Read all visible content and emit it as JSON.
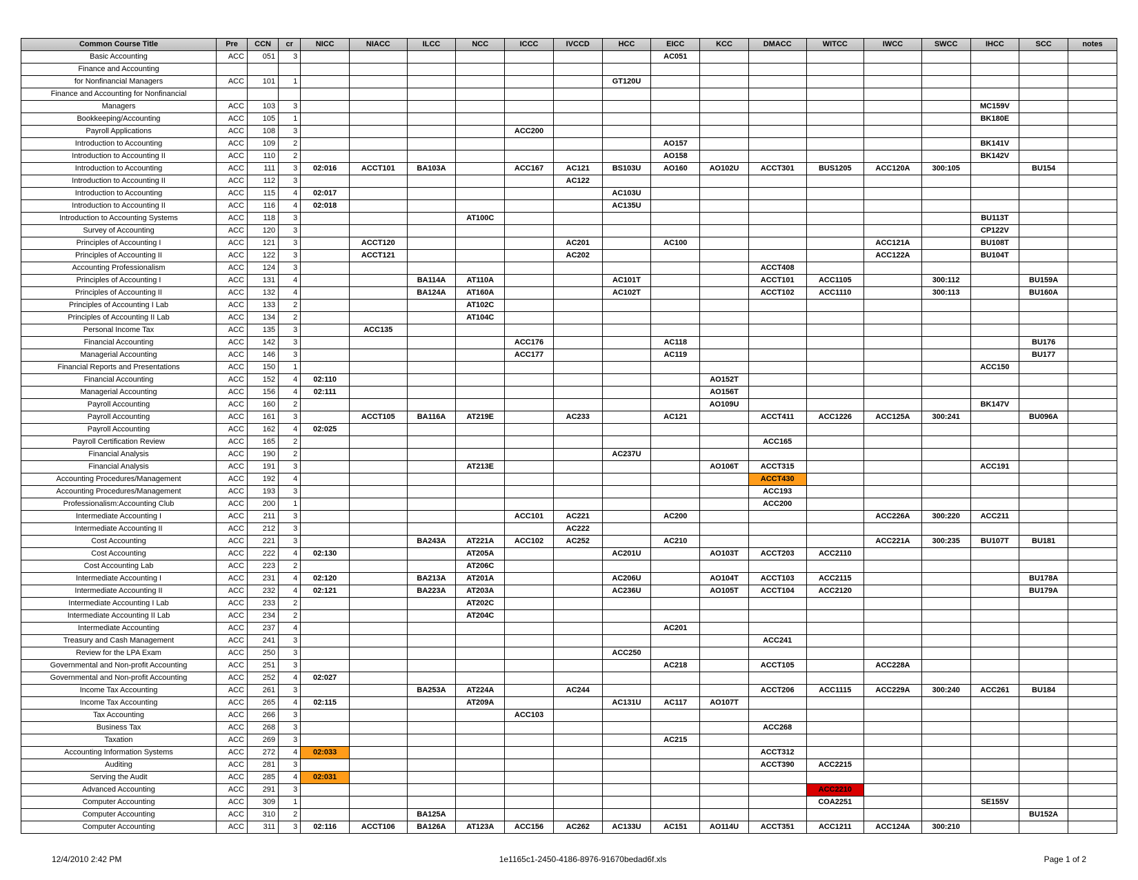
{
  "headers": [
    "Common Course Title",
    "Pre",
    "CCN",
    "cr",
    "NICC",
    "NIACC",
    "ILCC",
    "NCC",
    "ICCC",
    "IVCCD",
    "HCC",
    "EICC",
    "KCC",
    "DMACC",
    "WITCC",
    "IWCC",
    "SWCC",
    "IHCC",
    "SCC",
    "notes"
  ],
  "rows": [
    {
      "title": "Basic Accounting",
      "pre": "ACC",
      "ccn": "051",
      "cr": "3",
      "cells": {
        "EICC": "AC051"
      }
    },
    {
      "title": "Finance and Accounting",
      "multi": true
    },
    {
      "title": "for Nonfinancial Managers",
      "pre": "ACC",
      "ccn": "101",
      "cr": "1",
      "cells": {
        "HCC": "GT120U"
      }
    },
    {
      "title": "Finance and Accounting for Nonfinancial",
      "multi": true
    },
    {
      "title": "Managers",
      "pre": "ACC",
      "ccn": "103",
      "cr": "3",
      "cells": {
        "IHCC": "MC159V"
      }
    },
    {
      "title": "Bookkeeping/Accounting",
      "pre": "ACC",
      "ccn": "105",
      "cr": "1",
      "cells": {
        "IHCC": "BK180E"
      }
    },
    {
      "title": "Payroll Applications",
      "pre": "ACC",
      "ccn": "108",
      "cr": "3",
      "cells": {
        "ICCC": "ACC200"
      }
    },
    {
      "title": "Introduction to Accounting",
      "pre": "ACC",
      "ccn": "109",
      "cr": "2",
      "cells": {
        "EICC": "AO157",
        "IHCC": "BK141V"
      }
    },
    {
      "title": "Introduction to Accounting II",
      "pre": "ACC",
      "ccn": "110",
      "cr": "2",
      "cells": {
        "EICC": "AO158",
        "IHCC": "BK142V"
      }
    },
    {
      "title": "Introduction to Accounting",
      "pre": "ACC",
      "ccn": "111",
      "cr": "3",
      "cells": {
        "NICC": "02:016",
        "NIACC": "ACCT101",
        "ILCC": "BA103A",
        "ICCC": "ACC167",
        "IVCCD": "AC121",
        "HCC": "BS103U",
        "EICC": "AO160",
        "KCC": "AO102U",
        "DMACC": "ACCT301",
        "WITCC": "BUS1205",
        "IWCC": "ACC120A",
        "SWCC": "300:105",
        "SCC": "BU154"
      }
    },
    {
      "title": "Introduction to Accounting II",
      "pre": "ACC",
      "ccn": "112",
      "cr": "3",
      "cells": {
        "IVCCD": "AC122"
      }
    },
    {
      "title": "Introduction to Accounting",
      "pre": "ACC",
      "ccn": "115",
      "cr": "4",
      "cells": {
        "NICC": "02:017",
        "HCC": "AC103U"
      }
    },
    {
      "title": "Introduction to Accounting II",
      "pre": "ACC",
      "ccn": "116",
      "cr": "4",
      "cells": {
        "NICC": "02:018",
        "HCC": "AC135U"
      }
    },
    {
      "title": "Introduction to Accounting Systems",
      "pre": "ACC",
      "ccn": "118",
      "cr": "3",
      "cells": {
        "NCC": "AT100C",
        "IHCC": "BU113T"
      }
    },
    {
      "title": "Survey of Accounting",
      "pre": "ACC",
      "ccn": "120",
      "cr": "3",
      "cells": {
        "IHCC": "CP122V"
      }
    },
    {
      "title": "Principles of Accounting I",
      "pre": "ACC",
      "ccn": "121",
      "cr": "3",
      "cells": {
        "NIACC": "ACCT120",
        "IVCCD": "AC201",
        "EICC": "AC100",
        "IWCC": "ACC121A",
        "IHCC": "BU108T"
      }
    },
    {
      "title": "Principles of Accounting II",
      "pre": "ACC",
      "ccn": "122",
      "cr": "3",
      "cells": {
        "NIACC": "ACCT121",
        "IVCCD": "AC202",
        "IWCC": "ACC122A",
        "IHCC": "BU104T"
      }
    },
    {
      "title": "Accounting Professionalism",
      "pre": "ACC",
      "ccn": "124",
      "cr": "3",
      "cells": {
        "DMACC": "ACCT408"
      }
    },
    {
      "title": "Principles of Accounting I",
      "pre": "ACC",
      "ccn": "131",
      "cr": "4",
      "cells": {
        "ILCC": "BA114A",
        "NCC": "AT110A",
        "HCC": "AC101T",
        "DMACC": "ACCT101",
        "WITCC": "ACC1105",
        "SWCC": "300:112",
        "SCC": "BU159A"
      }
    },
    {
      "title": "Principles of Accounting II",
      "pre": "ACC",
      "ccn": "132",
      "cr": "4",
      "cells": {
        "ILCC": "BA124A",
        "NCC": "AT160A",
        "HCC": "AC102T",
        "DMACC": "ACCT102",
        "WITCC": "ACC1110",
        "SWCC": "300:113",
        "SCC": "BU160A"
      }
    },
    {
      "title": "Principles of Accounting I Lab",
      "pre": "ACC",
      "ccn": "133",
      "cr": "2",
      "cells": {
        "NCC": "AT102C"
      }
    },
    {
      "title": "Principles of Accounting II Lab",
      "pre": "ACC",
      "ccn": "134",
      "cr": "2",
      "cells": {
        "NCC": "AT104C"
      }
    },
    {
      "title": "Personal Income Tax",
      "pre": "ACC",
      "ccn": "135",
      "cr": "3",
      "cells": {
        "NIACC": "ACC135"
      }
    },
    {
      "title": "Financial Accounting",
      "pre": "ACC",
      "ccn": "142",
      "cr": "3",
      "cells": {
        "ICCC": "ACC176",
        "EICC": "AC118",
        "SCC": "BU176"
      }
    },
    {
      "title": "Managerial Accounting",
      "pre": "ACC",
      "ccn": "146",
      "cr": "3",
      "cells": {
        "ICCC": "ACC177",
        "EICC": "AC119",
        "SCC": "BU177"
      }
    },
    {
      "title": "Financial Reports and Presentations",
      "pre": "ACC",
      "ccn": "150",
      "cr": "1",
      "cells": {
        "IHCC": "ACC150"
      }
    },
    {
      "title": "Financial Accounting",
      "pre": "ACC",
      "ccn": "152",
      "cr": "4",
      "cells": {
        "NICC": "02:110",
        "KCC": "AO152T"
      }
    },
    {
      "title": "Managerial Accounting",
      "pre": "ACC",
      "ccn": "156",
      "cr": "4",
      "cells": {
        "NICC": "02:111",
        "KCC": "AO156T"
      }
    },
    {
      "title": "Payroll Accounting",
      "pre": "ACC",
      "ccn": "160",
      "cr": "2",
      "cells": {
        "KCC": "AO109U",
        "IHCC": "BK147V"
      }
    },
    {
      "title": "Payroll Accounting",
      "pre": "ACC",
      "ccn": "161",
      "cr": "3",
      "cells": {
        "NIACC": "ACCT105",
        "ILCC": "BA116A",
        "NCC": "AT219E",
        "IVCCD": "AC233",
        "EICC": "AC121",
        "DMACC": "ACCT411",
        "WITCC": "ACC1226",
        "IWCC": "ACC125A",
        "SWCC": "300:241",
        "SCC": "BU096A"
      }
    },
    {
      "title": "Payroll Accounting",
      "pre": "ACC",
      "ccn": "162",
      "cr": "4",
      "cells": {
        "NICC": "02:025"
      }
    },
    {
      "title": "Payroll Certification Review",
      "pre": "ACC",
      "ccn": "165",
      "cr": "2",
      "cells": {
        "DMACC": "ACC165"
      }
    },
    {
      "title": "Financial Analysis",
      "pre": "ACC",
      "ccn": "190",
      "cr": "2",
      "cells": {
        "HCC": "AC237U"
      }
    },
    {
      "title": "Financial Analysis",
      "pre": "ACC",
      "ccn": "191",
      "cr": "3",
      "cells": {
        "NCC": "AT213E",
        "KCC": "AO106T",
        "DMACC": "ACCT315",
        "IHCC": "ACC191"
      }
    },
    {
      "title": "Accounting Procedures/Management",
      "pre": "ACC",
      "ccn": "192",
      "cr": "4",
      "cells": {
        "DMACC": {
          "v": "ACCT430",
          "hl": "orange"
        }
      }
    },
    {
      "title": "Accounting Procedures/Management",
      "pre": "ACC",
      "ccn": "193",
      "cr": "3",
      "cells": {
        "DMACC": "ACC193"
      }
    },
    {
      "title": "Professionalism:Accounting Club",
      "pre": "ACC",
      "ccn": "200",
      "cr": "1",
      "cells": {
        "DMACC": "ACC200"
      }
    },
    {
      "title": "Intermediate Accounting I",
      "pre": "ACC",
      "ccn": "211",
      "cr": "3",
      "cells": {
        "ICCC": "ACC101",
        "IVCCD": "AC221",
        "EICC": "AC200",
        "IWCC": "ACC226A",
        "SWCC": "300:220",
        "IHCC": "ACC211"
      }
    },
    {
      "title": "Intermediate Accounting II",
      "pre": "ACC",
      "ccn": "212",
      "cr": "3",
      "cells": {
        "IVCCD": "AC222"
      }
    },
    {
      "title": "Cost Accounting",
      "pre": "ACC",
      "ccn": "221",
      "cr": "3",
      "cells": {
        "ILCC": "BA243A",
        "NCC": "AT221A",
        "ICCC": "ACC102",
        "IVCCD": "AC252",
        "EICC": "AC210",
        "IWCC": "ACC221A",
        "SWCC": "300:235",
        "IHCC": "BU107T",
        "SCC": "BU181"
      }
    },
    {
      "title": "Cost Accounting",
      "pre": "ACC",
      "ccn": "222",
      "cr": "4",
      "cells": {
        "NICC": "02:130",
        "NCC": "AT205A",
        "HCC": "AC201U",
        "KCC": "AO103T",
        "DMACC": "ACCT203",
        "WITCC": "ACC2110"
      }
    },
    {
      "title": "Cost Accounting Lab",
      "pre": "ACC",
      "ccn": "223",
      "cr": "2",
      "cells": {
        "NCC": "AT206C"
      }
    },
    {
      "title": "Intermediate Accounting I",
      "pre": "ACC",
      "ccn": "231",
      "cr": "4",
      "cells": {
        "NICC": "02:120",
        "ILCC": "BA213A",
        "NCC": "AT201A",
        "HCC": "AC206U",
        "KCC": "AO104T",
        "DMACC": "ACCT103",
        "WITCC": "ACC2115",
        "SCC": "BU178A"
      }
    },
    {
      "title": "Intermediate Accounting II",
      "pre": "ACC",
      "ccn": "232",
      "cr": "4",
      "cells": {
        "NICC": "02:121",
        "ILCC": "BA223A",
        "NCC": "AT203A",
        "HCC": "AC236U",
        "KCC": "AO105T",
        "DMACC": "ACCT104",
        "WITCC": "ACC2120",
        "SCC": "BU179A"
      }
    },
    {
      "title": "Intermediate Accounting I Lab",
      "pre": "ACC",
      "ccn": "233",
      "cr": "2",
      "cells": {
        "NCC": "AT202C"
      }
    },
    {
      "title": "Intermediate Accounting II Lab",
      "pre": "ACC",
      "ccn": "234",
      "cr": "2",
      "cells": {
        "NCC": "AT204C"
      }
    },
    {
      "title": "Intermediate Accounting",
      "pre": "ACC",
      "ccn": "237",
      "cr": "4",
      "cells": {
        "EICC": "AC201"
      }
    },
    {
      "title": "Treasury and Cash Management",
      "pre": "ACC",
      "ccn": "241",
      "cr": "3",
      "cells": {
        "DMACC": "ACC241"
      }
    },
    {
      "title": "Review for the LPA Exam",
      "pre": "ACC",
      "ccn": "250",
      "cr": "3",
      "cells": {
        "HCC": "ACC250"
      }
    },
    {
      "title": "Governmental and Non-profit Accounting",
      "pre": "ACC",
      "ccn": "251",
      "cr": "3",
      "cells": {
        "EICC": "AC218",
        "DMACC": "ACCT105",
        "IWCC": "ACC228A"
      }
    },
    {
      "title": "Governmental and Non-profit Accounting",
      "pre": "ACC",
      "ccn": "252",
      "cr": "4",
      "cells": {
        "NICC": "02:027"
      }
    },
    {
      "title": "Income Tax Accounting",
      "pre": "ACC",
      "ccn": "261",
      "cr": "3",
      "cells": {
        "ILCC": "BA253A",
        "NCC": "AT224A",
        "IVCCD": "AC244",
        "DMACC": "ACCT206",
        "WITCC": "ACC1115",
        "IWCC": "ACC229A",
        "SWCC": "300:240",
        "IHCC": "ACC261",
        "SCC": "BU184"
      }
    },
    {
      "title": "Income Tax Accounting",
      "pre": "ACC",
      "ccn": "265",
      "cr": "4",
      "cells": {
        "NICC": "02:115",
        "NCC": "AT209A",
        "HCC": "AC131U",
        "EICC": "AC117",
        "KCC": "AO107T"
      }
    },
    {
      "title": "Tax Accounting",
      "pre": "ACC",
      "ccn": "266",
      "cr": "3",
      "cells": {
        "ICCC": "ACC103"
      }
    },
    {
      "title": "Business Tax",
      "pre": "ACC",
      "ccn": "268",
      "cr": "3",
      "cells": {
        "DMACC": "ACC268"
      }
    },
    {
      "title": "Taxation",
      "pre": "ACC",
      "ccn": "269",
      "cr": "3",
      "cells": {
        "EICC": "AC215"
      }
    },
    {
      "title": "Accounting Information Systems",
      "pre": "ACC",
      "ccn": "272",
      "cr": "4",
      "cells": {
        "NICC": {
          "v": "02:033",
          "hl": "orange"
        },
        "DMACC": "ACCT312"
      }
    },
    {
      "title": "Auditing",
      "pre": "ACC",
      "ccn": "281",
      "cr": "3",
      "cells": {
        "DMACC": "ACCT390",
        "WITCC": "ACC2215"
      }
    },
    {
      "title": "Serving the Audit",
      "pre": "ACC",
      "ccn": "285",
      "cr": "4",
      "cells": {
        "NICC": {
          "v": "02:031",
          "hl": "orange"
        }
      }
    },
    {
      "title": "Advanced Accounting",
      "pre": "ACC",
      "ccn": "291",
      "cr": "3",
      "cells": {
        "WITCC": {
          "v": "ACC2210",
          "hl": "red"
        }
      }
    },
    {
      "title": "Computer Accounting",
      "pre": "ACC",
      "ccn": "309",
      "cr": "1",
      "cells": {
        "WITCC": "COA2251",
        "IHCC": "SE155V"
      }
    },
    {
      "title": "Computer Accounting",
      "pre": "ACC",
      "ccn": "310",
      "cr": "2",
      "cells": {
        "ILCC": "BA125A",
        "SCC": "BU152A"
      }
    },
    {
      "title": "Computer Accounting",
      "pre": "ACC",
      "ccn": "311",
      "cr": "3",
      "cells": {
        "NICC": "02:116",
        "NIACC": "ACCT106",
        "ILCC": "BA126A",
        "NCC": "AT123A",
        "ICCC": "ACC156",
        "IVCCD": "AC262",
        "HCC": "AC133U",
        "EICC": "AC151",
        "KCC": "AO114U",
        "DMACC": "ACCT351",
        "WITCC": "ACC1211",
        "IWCC": "ACC124A",
        "SWCC": "300:210"
      }
    }
  ],
  "codeCols": [
    "NICC",
    "NIACC",
    "ILCC",
    "NCC",
    "ICCC",
    "IVCCD",
    "HCC",
    "EICC",
    "KCC",
    "DMACC",
    "WITCC",
    "IWCC",
    "SWCC",
    "IHCC",
    "SCC",
    "notes"
  ],
  "footer": {
    "left": "12/4/2010 2:42 PM",
    "center": "1e1165c1-2450-4186-8976-91670bedad6f.xls",
    "right": "Page 1 of 2"
  }
}
